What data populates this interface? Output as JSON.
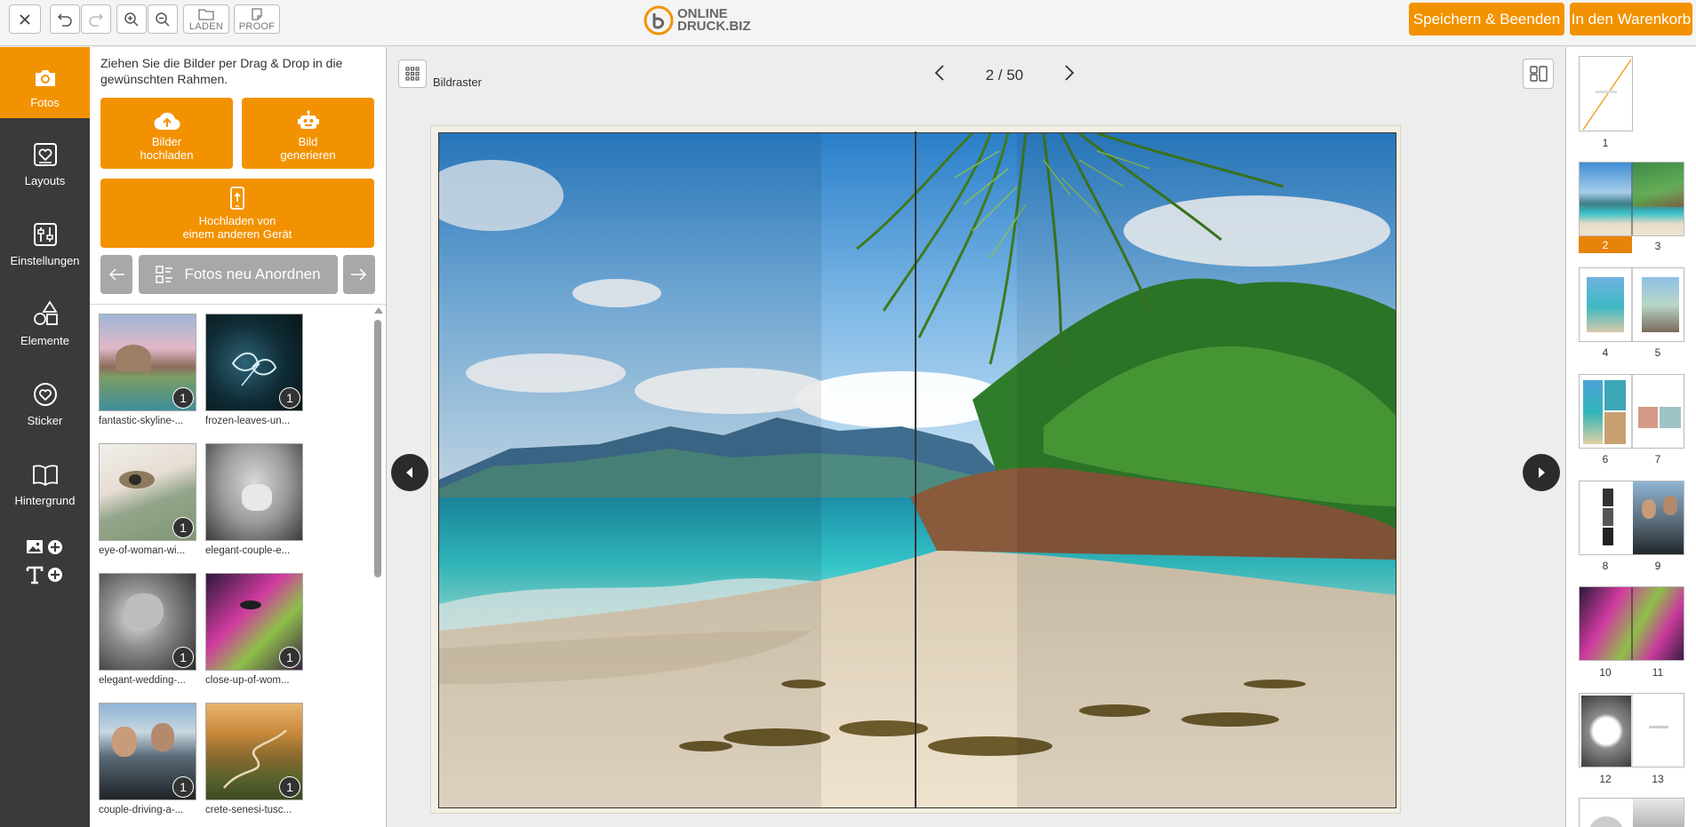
{
  "toolbar": {
    "load_label": "LADEN",
    "proof_label": "PROOF",
    "brand_line1": "ONLINE",
    "brand_line2": "DRUCK.BIZ",
    "save_exit_label": "Speichern & Beenden",
    "cart_label": "In den Warenkorb"
  },
  "nav": {
    "items": [
      {
        "label": "Fotos",
        "icon": "camera-icon",
        "active": true
      },
      {
        "label": "Layouts",
        "icon": "layout-heart-icon"
      },
      {
        "label": "Einstellungen",
        "icon": "sliders-icon"
      },
      {
        "label": "Elemente",
        "icon": "shapes-icon"
      },
      {
        "label": "Sticker",
        "icon": "sticker-heart-icon"
      },
      {
        "label": "Hintergrund",
        "icon": "book-icon"
      }
    ]
  },
  "photos_panel": {
    "instructions": "Ziehen Sie die Bilder per Drag & Drop in die gewünschten Rahmen.",
    "upload_line1": "Bilder",
    "upload_line2": "hochladen",
    "generate_line1": "Bild",
    "generate_line2": "generieren",
    "device_line1": "Hochladen von",
    "device_line2": "einem anderen Gerät",
    "rearrange_label": "Fotos neu Anordnen",
    "photos": [
      {
        "caption": "fantastic-skyline-...",
        "count": "1"
      },
      {
        "caption": "frozen-leaves-un...",
        "count": "1"
      },
      {
        "caption": "eye-of-woman-wi...",
        "count": "1"
      },
      {
        "caption": "elegant-couple-e...",
        "count": ""
      },
      {
        "caption": "elegant-wedding-...",
        "count": "1"
      },
      {
        "caption": "close-up-of-wom...",
        "count": "1"
      },
      {
        "caption": "couple-driving-a-...",
        "count": "1"
      },
      {
        "caption": "crete-senesi-tusc...",
        "count": "1"
      }
    ]
  },
  "editor": {
    "grid_label": "Bildraster",
    "page_indicator": "2 / 50"
  },
  "pages": {
    "numbers": [
      "1",
      "2",
      "3",
      "4",
      "5",
      "6",
      "7",
      "8",
      "9",
      "10",
      "11",
      "12",
      "13"
    ],
    "selected": "2"
  },
  "colors": {
    "accent": "#f39200",
    "sidebar": "#3a3a3a",
    "button_grey": "#a8a8a8"
  }
}
